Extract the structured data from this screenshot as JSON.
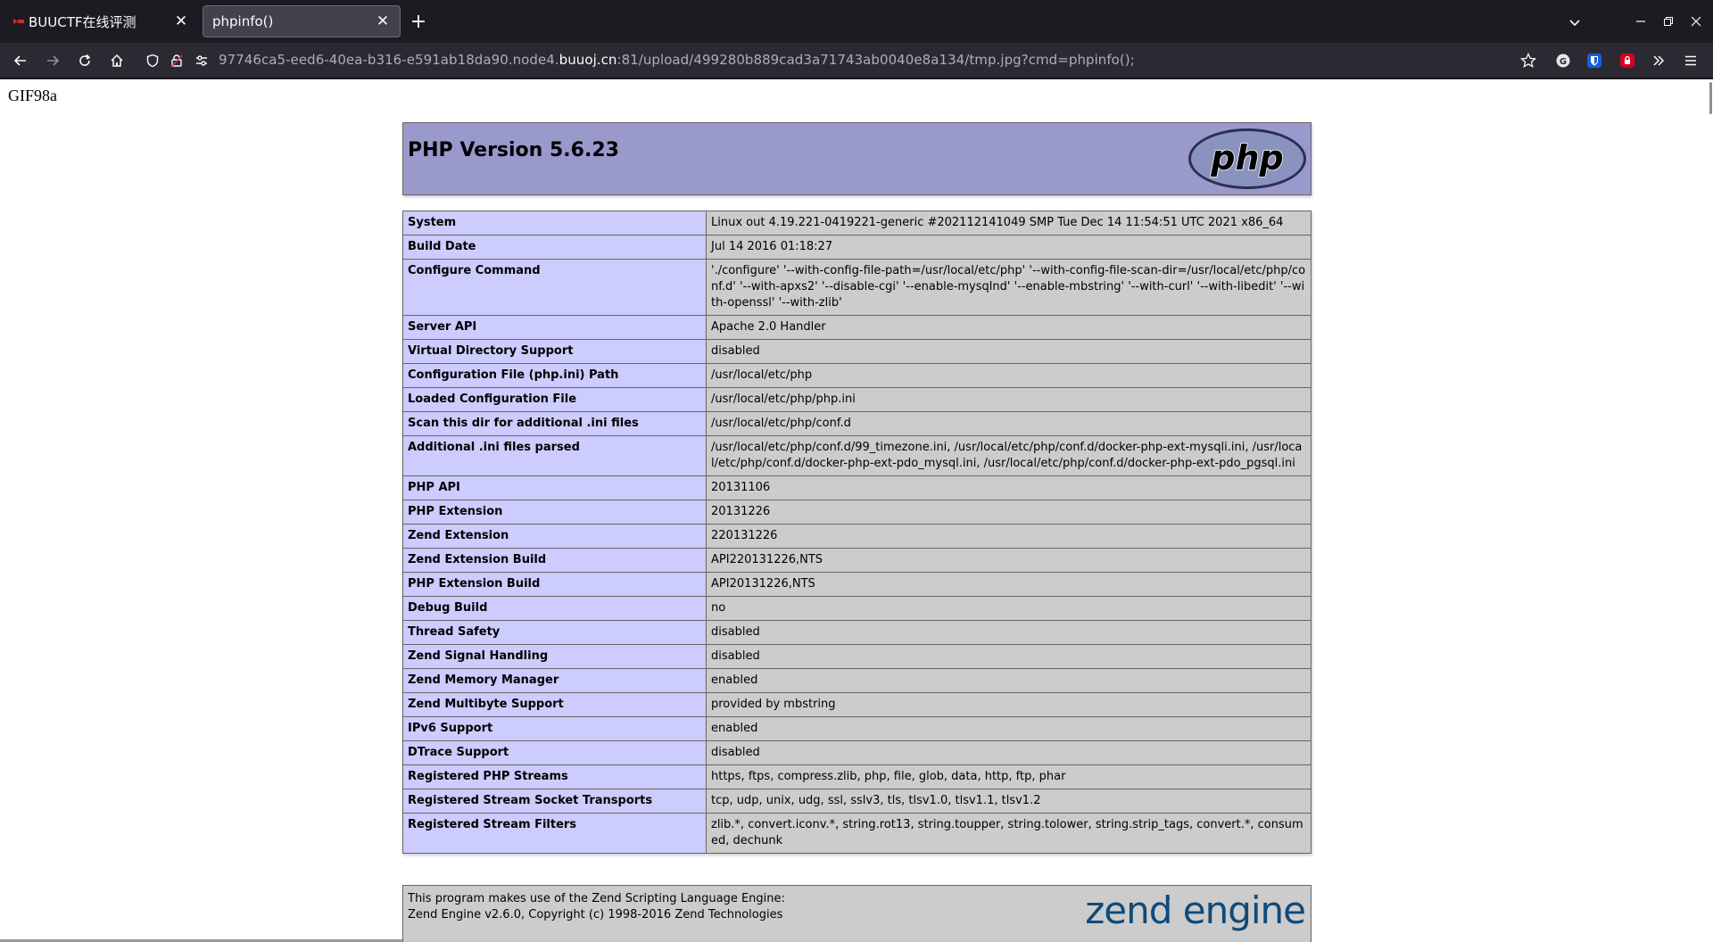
{
  "browser": {
    "tabs": [
      {
        "label": "BUUCTF在线评测",
        "active": false
      },
      {
        "label": "phpinfo()",
        "active": true
      }
    ],
    "url": {
      "prefix": "97746ca5-eed6-40ea-b316-e591ab18da90.node4.",
      "host": "buuoj.cn",
      "suffix": ":81/upload/499280b889cad3a71743ab0040e8a134/tmp.jpg?cmd=phpinfo();"
    }
  },
  "page": {
    "gif_header": "GIF98a",
    "php_version_title": "PHP Version 5.6.23",
    "info_rows": [
      {
        "key": "System",
        "value": "Linux out 4.19.221-0419221-generic #202112141049 SMP Tue Dec 14 11:54:51 UTC 2021 x86_64"
      },
      {
        "key": "Build Date",
        "value": "Jul 14 2016 01:18:27"
      },
      {
        "key": "Configure Command",
        "value": "'./configure' '--with-config-file-path=/usr/local/etc/php' '--with-config-file-scan-dir=/usr/local/etc/php/conf.d' '--with-apxs2' '--disable-cgi' '--enable-mysqlnd' '--enable-mbstring' '--with-curl' '--with-libedit' '--with-openssl' '--with-zlib'"
      },
      {
        "key": "Server API",
        "value": "Apache 2.0 Handler"
      },
      {
        "key": "Virtual Directory Support",
        "value": "disabled"
      },
      {
        "key": "Configuration File (php.ini) Path",
        "value": "/usr/local/etc/php"
      },
      {
        "key": "Loaded Configuration File",
        "value": "/usr/local/etc/php/php.ini"
      },
      {
        "key": "Scan this dir for additional .ini files",
        "value": "/usr/local/etc/php/conf.d"
      },
      {
        "key": "Additional .ini files parsed",
        "value": "/usr/local/etc/php/conf.d/99_timezone.ini, /usr/local/etc/php/conf.d/docker-php-ext-mysqli.ini, /usr/local/etc/php/conf.d/docker-php-ext-pdo_mysql.ini, /usr/local/etc/php/conf.d/docker-php-ext-pdo_pgsql.ini"
      },
      {
        "key": "PHP API",
        "value": "20131106"
      },
      {
        "key": "PHP Extension",
        "value": "20131226"
      },
      {
        "key": "Zend Extension",
        "value": "220131226"
      },
      {
        "key": "Zend Extension Build",
        "value": "API220131226,NTS"
      },
      {
        "key": "PHP Extension Build",
        "value": "API20131226,NTS"
      },
      {
        "key": "Debug Build",
        "value": "no"
      },
      {
        "key": "Thread Safety",
        "value": "disabled"
      },
      {
        "key": "Zend Signal Handling",
        "value": "disabled"
      },
      {
        "key": "Zend Memory Manager",
        "value": "enabled"
      },
      {
        "key": "Zend Multibyte Support",
        "value": "provided by mbstring"
      },
      {
        "key": "IPv6 Support",
        "value": "enabled"
      },
      {
        "key": "DTrace Support",
        "value": "disabled"
      },
      {
        "key": "Registered PHP Streams",
        "value": "https, ftps, compress.zlib, php, file, glob, data, http, ftp, phar"
      },
      {
        "key": "Registered Stream Socket Transports",
        "value": "tcp, udp, unix, udg, ssl, sslv3, tls, tlsv1.0, tlsv1.1, tlsv1.2"
      },
      {
        "key": "Registered Stream Filters",
        "value": "zlib.*, convert.iconv.*, string.rot13, string.toupper, string.tolower, string.strip_tags, convert.*, consumed, dechunk"
      }
    ],
    "zend_line1": "This program makes use of the Zend Scripting Language Engine:",
    "zend_line2": "Zend Engine v2.6.0, Copyright (c) 1998-2016 Zend Technologies",
    "php_logo_text": "php",
    "zend_logo_text": "zend engine"
  },
  "colors": {
    "header_bg": "#9999cc",
    "key_cell_bg": "#ccccff",
    "value_cell_bg": "#cccccc",
    "browser_chrome": "#2b2a33"
  }
}
